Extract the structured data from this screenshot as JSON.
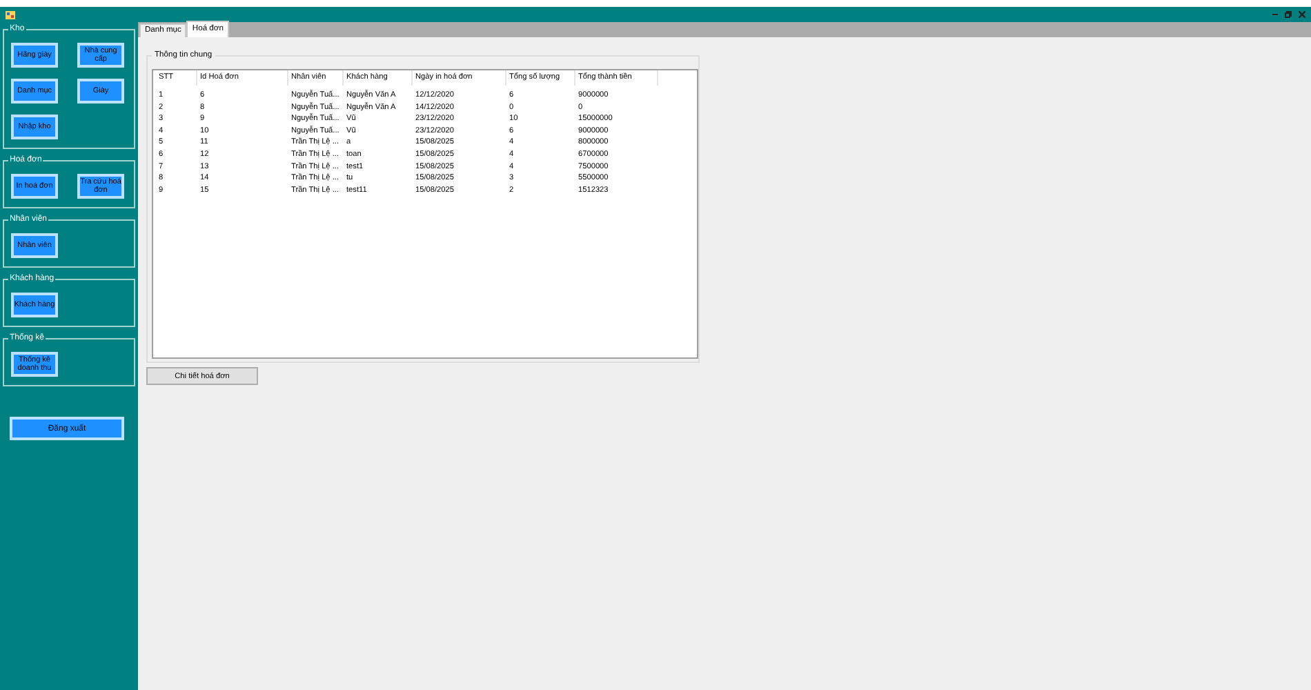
{
  "sidebar": {
    "groups": [
      {
        "title": "Kho",
        "buttons": [
          "Hãng giày",
          "Nhà cung cấp",
          "Danh mục",
          "Giày",
          "Nhập kho"
        ]
      },
      {
        "title": "Hoá đơn",
        "buttons": [
          "In hoá đơn",
          "Tra cứu hoá đơn"
        ]
      },
      {
        "title": "Nhân viên",
        "buttons": [
          "Nhân viên"
        ]
      },
      {
        "title": "Khách hàng",
        "buttons": [
          "Khách hàng"
        ]
      },
      {
        "title": "Thống kê",
        "buttons": [
          "Thống kê doanh thu"
        ]
      }
    ],
    "logout_button": "Đăng xuất"
  },
  "tabs": [
    {
      "label": "Danh mục",
      "selected": false
    },
    {
      "label": "Hoá đơn",
      "selected": true
    }
  ],
  "group_box": {
    "title": "Thông tin chung"
  },
  "table": {
    "columns": [
      "STT",
      "Id Hoá đơn",
      "Nhân viên",
      "Khách hàng",
      "Ngày in hoá đơn",
      "Tổng số lượng",
      "Tổng thành tiền"
    ],
    "rows": [
      [
        "1",
        "6",
        "Nguyễn Tuấ...",
        "Nguyễn Văn A",
        "12/12/2020",
        "6",
        "9000000"
      ],
      [
        "2",
        "8",
        "Nguyễn Tuấ...",
        "Nguyễn Văn A",
        "14/12/2020",
        "0",
        "0"
      ],
      [
        "3",
        "9",
        "Nguyễn Tuấ...",
        "Vũ",
        "23/12/2020",
        "10",
        "15000000"
      ],
      [
        "4",
        "10",
        "Nguyễn Tuấ...",
        "Vũ",
        "23/12/2020",
        "6",
        "9000000"
      ],
      [
        "5",
        "11",
        "Trần Thị Lệ ...",
        "a",
        "15/08/2025",
        "4",
        "8000000"
      ],
      [
        "6",
        "12",
        "Trần Thị Lệ ...",
        "toan",
        "15/08/2025",
        "4",
        "6700000"
      ],
      [
        "7",
        "13",
        "Trần Thị Lệ ...",
        "test1",
        "15/08/2025",
        "4",
        "7500000"
      ],
      [
        "8",
        "14",
        "Trần Thị Lệ ...",
        "tu",
        "15/08/2025",
        "3",
        "5500000"
      ],
      [
        "9",
        "15",
        "Trần Thị Lệ ...",
        "test11",
        "15/08/2025",
        "2",
        "1512323"
      ]
    ]
  },
  "detail_button": "Chi tiết hoá đơn"
}
